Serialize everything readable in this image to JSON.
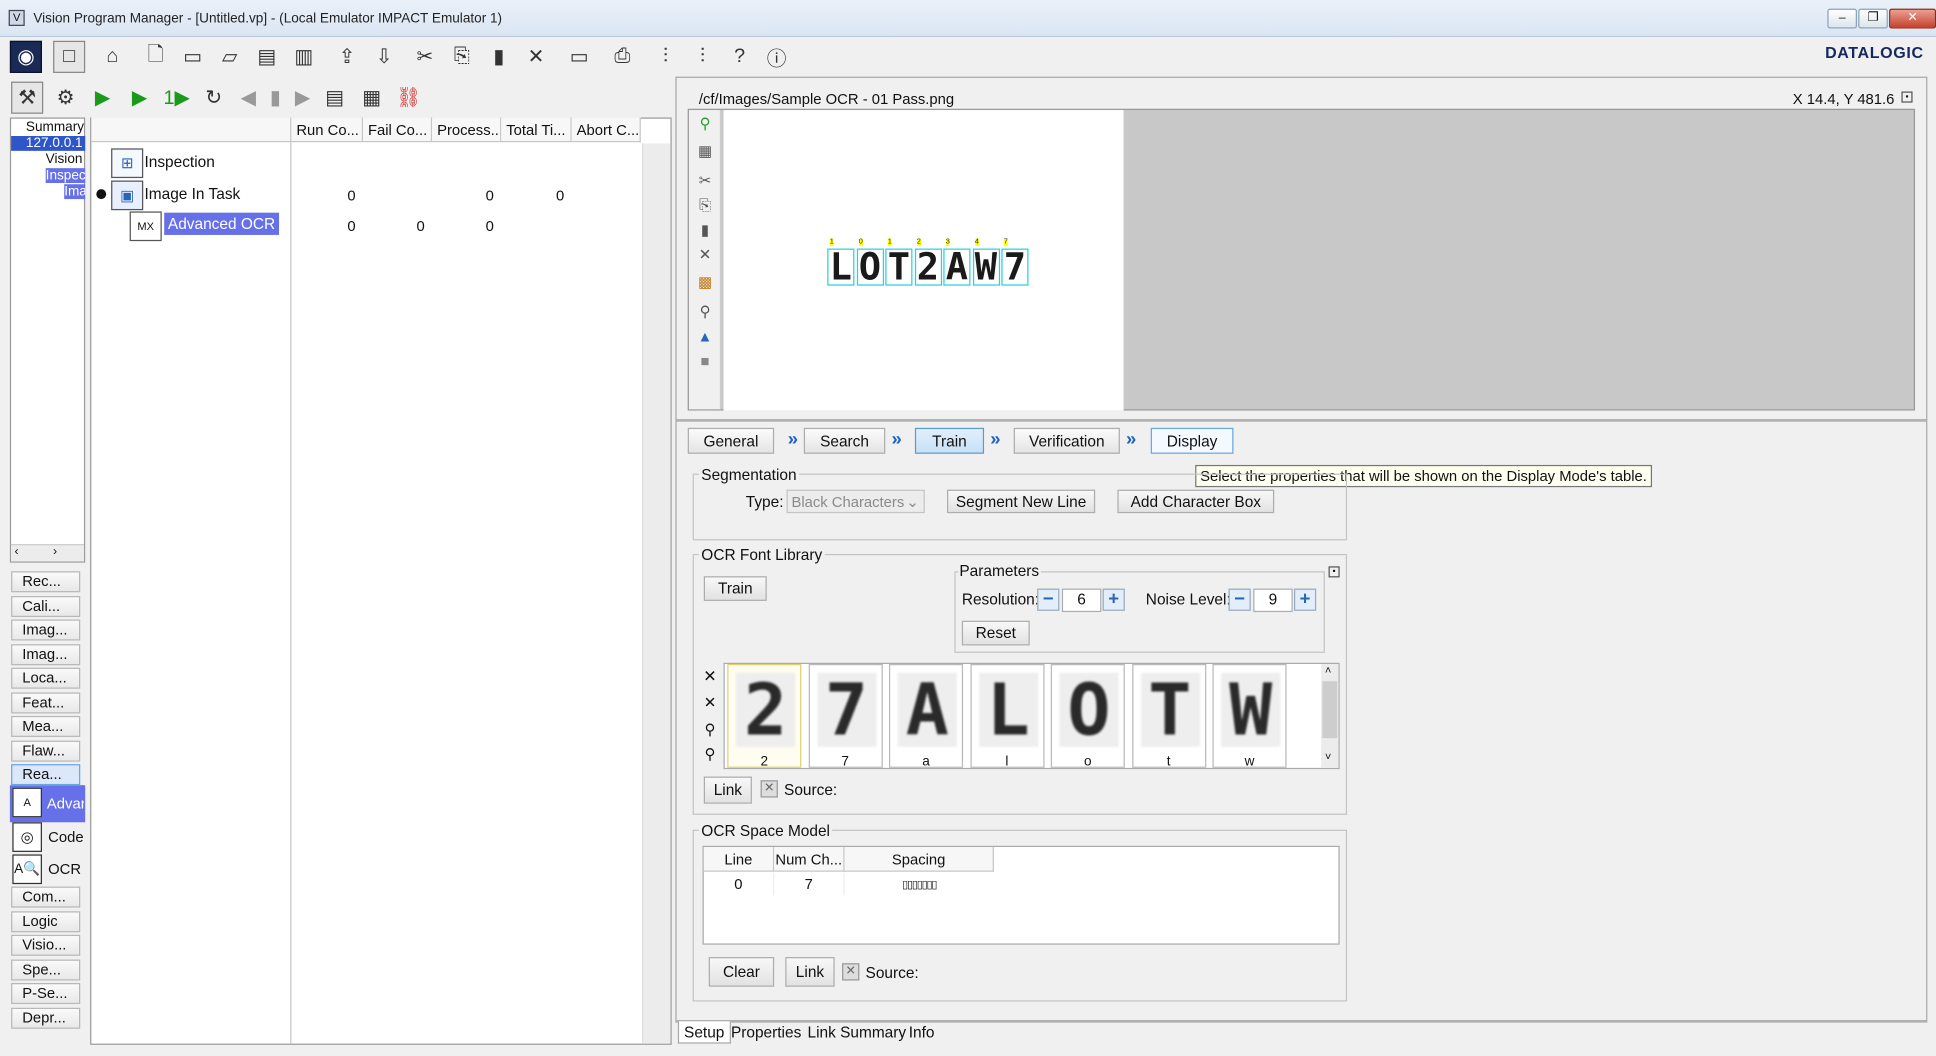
{
  "window": {
    "title": "Vision Program Manager - [Untitled.vp] - (Local Emulator IMPACT Emulator 1)",
    "brand": "DATALOGIC"
  },
  "tree": {
    "items": [
      "Summary",
      "127.0.0.1",
      "Vision",
      "Inspec",
      "Ima"
    ]
  },
  "categories": [
    "Rec...",
    "Cali...",
    "Imag...",
    "Imag...",
    "Loca...",
    "Feat...",
    "Mea...",
    "Flaw...",
    "Rea..."
  ],
  "tools": [
    "Advar",
    "Code",
    "OCR"
  ],
  "categories2": [
    "Com...",
    "Logic",
    "Visio...",
    "Spe...",
    "P-Se...",
    "Depr..."
  ],
  "table": {
    "columns": [
      "Run Co...",
      "Fail Co...",
      "Process...",
      "Total Ti...",
      "Abort C..."
    ],
    "rows": [
      {
        "name": "Inspection",
        "vals": [
          "",
          "",
          "",
          "",
          ""
        ]
      },
      {
        "name": "Image In Task",
        "vals": [
          "0",
          "",
          "0",
          "0",
          ""
        ]
      },
      {
        "name": "Advanced OCR",
        "vals": [
          "0",
          "0",
          "0",
          "",
          ""
        ]
      }
    ]
  },
  "image": {
    "path": "/cf/Images/Sample OCR - 01 Pass.png",
    "coords": "X 14.4,  Y 481.6",
    "ocr_text": "LOT2AW7",
    "char_idx": [
      "1",
      "0",
      "1",
      "2",
      "3",
      "4",
      "7"
    ]
  },
  "tabs": [
    "General",
    "Search",
    "Train",
    "Verification",
    "Display"
  ],
  "tooltip": "Select the properties that will be shown on the Display Mode's table.",
  "segmentation": {
    "title": "Segmentation",
    "type_label": "Type:",
    "type_value": "Black Characters",
    "segment_btn": "Segment New Line",
    "add_box_btn": "Add Character Box"
  },
  "font_library": {
    "title": "OCR Font Library",
    "train_btn": "Train",
    "params_title": "Parameters",
    "resolution_label": "Resolution:",
    "resolution": "6",
    "noise_label": "Noise Level:",
    "noise": "9",
    "reset_btn": "Reset",
    "link_btn": "Link",
    "source_label": "Source:",
    "glyphs": [
      {
        "g": "2",
        "c": "2"
      },
      {
        "g": "7",
        "c": "7"
      },
      {
        "g": "A",
        "c": "a"
      },
      {
        "g": "L",
        "c": "l"
      },
      {
        "g": "O",
        "c": "o"
      },
      {
        "g": "T",
        "c": "t"
      },
      {
        "g": "W",
        "c": "w"
      }
    ]
  },
  "space_model": {
    "title": "OCR Space Model",
    "columns": [
      "Line",
      "Num Ch...",
      "Spacing"
    ],
    "row": [
      "0",
      "7",
      "▯▯▯▯▯▯▯"
    ],
    "clear_btn": "Clear",
    "link_btn": "Link",
    "source_label": "Source:"
  },
  "bottom_tabs": [
    "Setup",
    "Properties",
    "Link Summary",
    "Info"
  ]
}
